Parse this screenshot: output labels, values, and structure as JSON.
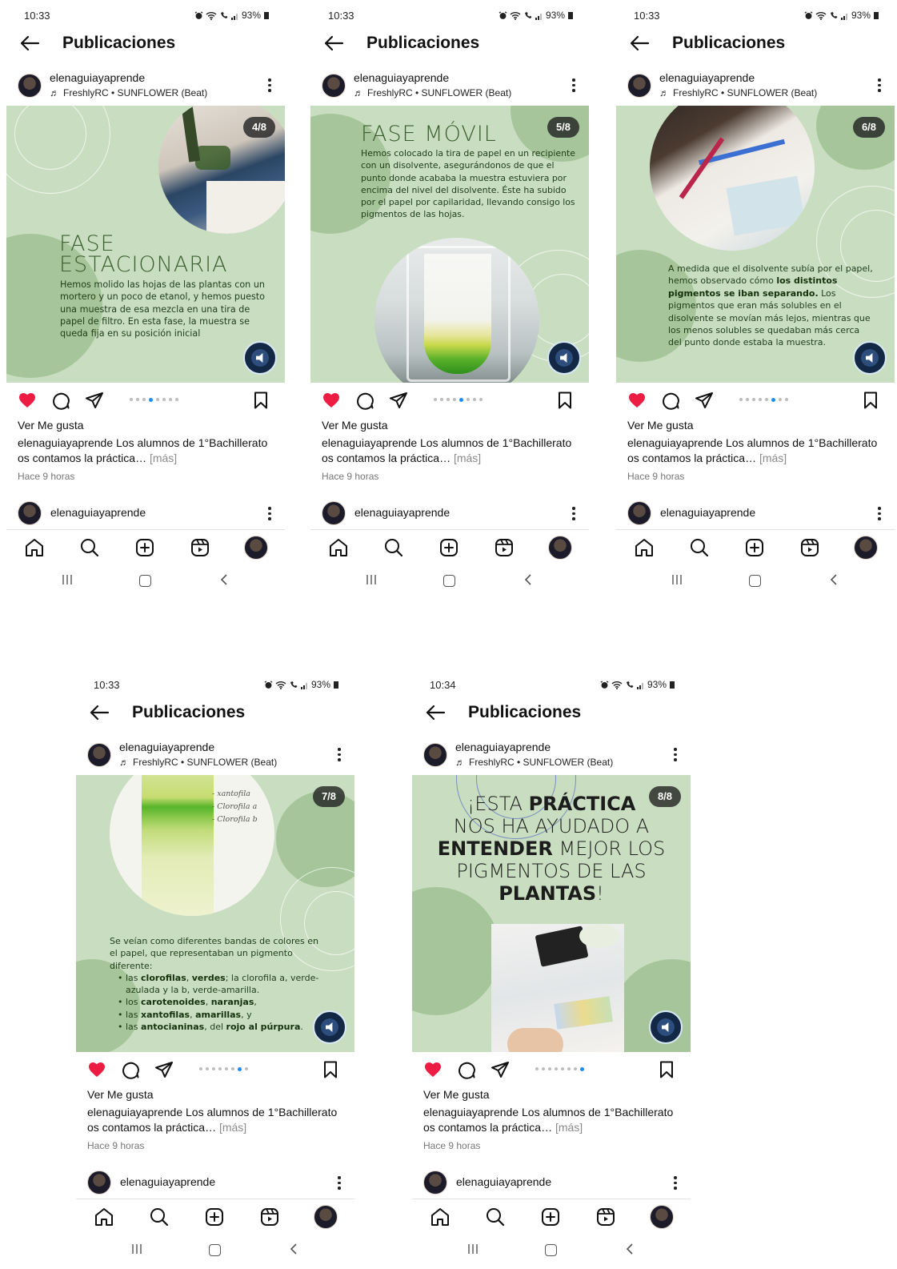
{
  "common": {
    "page_title": "Publicaciones",
    "username": "elenaguiayaprende",
    "music": "FreshlyRC • SUNFLOWER (Beat)",
    "likes_label": "Ver Me gusta",
    "caption_user": "elenaguiayaprende",
    "caption_text": " Los alumnos de 1°Bachillerato os contamos la práctica…",
    "more_label": "[más]",
    "time_ago": "Hace 9 horas",
    "next_post_username": "elenaguiayaprende",
    "battery": "93%",
    "colors": {
      "slide_bg": "#c9dec0",
      "blob": "#a6c59a",
      "like": "#ed1c43",
      "dot_active": "#1d8cf5"
    }
  },
  "screens": [
    {
      "time": "10:33",
      "counter": "4/8",
      "active_dot": 4
    },
    {
      "time": "10:33",
      "counter": "5/8",
      "active_dot": 5
    },
    {
      "time": "10:33",
      "counter": "6/8",
      "active_dot": 6
    },
    {
      "time": "10:33",
      "counter": "7/8",
      "active_dot": 7
    },
    {
      "time": "10:34",
      "counter": "8/8",
      "active_dot": 8
    }
  ],
  "slides": {
    "s4": {
      "heading_1": "FASE",
      "heading_2": "ESTACIONARIA",
      "body": "Hemos molido las hojas de las plantas con un mortero y un poco de etanol, y hemos puesto una muestra de esa mezcla en una tira de papel de filtro. En esta fase, la muestra se queda fija en su posición inicial"
    },
    "s5": {
      "heading": "FASE MÓVIL",
      "body": "Hemos colocado la tira de papel en un recipiente con un disolvente, asegurándonos de que el punto donde acababa la muestra estuviera por encima del nivel del disolvente. Éste ha subido por el papel por capilaridad, llevando consigo los pigmentos de las hojas."
    },
    "s6": {
      "body_1": "A medida que el disolvente subía por el papel, hemos observado cómo ",
      "body_bold": "los distintos pigmentos se iban separando.",
      "body_2": " Los pigmentos que eran más solubles en el disolvente se movían más lejos, mientras que los menos solubles se quedaban más cerca del punto donde estaba la muestra."
    },
    "s7": {
      "intro": "Se veían como diferentes bandas de colores en el papel, que representaban un pigmento diferente:",
      "photo_labels": [
        "- xantofila",
        "- Clorofila a",
        "- Clorofila b"
      ],
      "b1_pre": "las ",
      "b1_bold1": "clorofilas",
      "b1_mid": ", ",
      "b1_bold2": "verdes",
      "b1_post": "; la clorofila a, verde-azulada y la b, verde-amarilla.",
      "b2_pre": "los ",
      "b2_bold1": "carotenoides",
      "b2_mid": ", ",
      "b2_bold2": "naranjas",
      "b2_post": ",",
      "b3_pre": "las ",
      "b3_bold1": "xantofilas",
      "b3_mid": ", ",
      "b3_bold2": "amarillas",
      "b3_post": ", y",
      "b4_pre": "las ",
      "b4_bold1": "antocianinas",
      "b4_mid": ", del ",
      "b4_bold2": "rojo al púrpura",
      "b4_post": "."
    },
    "s8": {
      "l1_light": "¡ESTA ",
      "l1_bold": "PRÁCTICA",
      "l2_light": "NOS HA AYUDADO A",
      "l3_bold": "ENTENDER",
      "l3_light": " MEJOR LOS",
      "l4_light": "PIGMENTOS DE LAS",
      "l5_bold": "PLANTAS",
      "l5_light": "!"
    }
  }
}
